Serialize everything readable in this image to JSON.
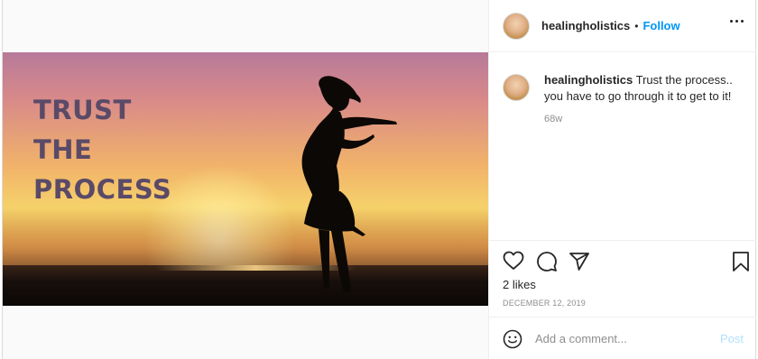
{
  "post": {
    "username": "healingholistics",
    "separator": "•",
    "follow_label": "Follow",
    "overlay_lines": [
      "TRUST",
      "THE",
      "PROCESS"
    ],
    "caption_text": "Trust the process.. you have to go through it to get to it!",
    "time_ago": "68w",
    "likes": "2 likes",
    "date": "DECEMBER 12, 2019",
    "comment_placeholder": "Add a comment...",
    "post_label": "Post"
  },
  "icons": {
    "more": "more-options-icon",
    "mute": "volume-muted-icon",
    "like": "heart-icon",
    "comment": "comment-icon",
    "share": "paper-plane-icon",
    "save": "bookmark-icon",
    "emoji": "emoji-icon"
  },
  "colors": {
    "accent": "#0095f6",
    "post_disabled": "#b2dffc",
    "secondary_text": "#8e8e8e",
    "overlay_text": "#5a4a68"
  }
}
